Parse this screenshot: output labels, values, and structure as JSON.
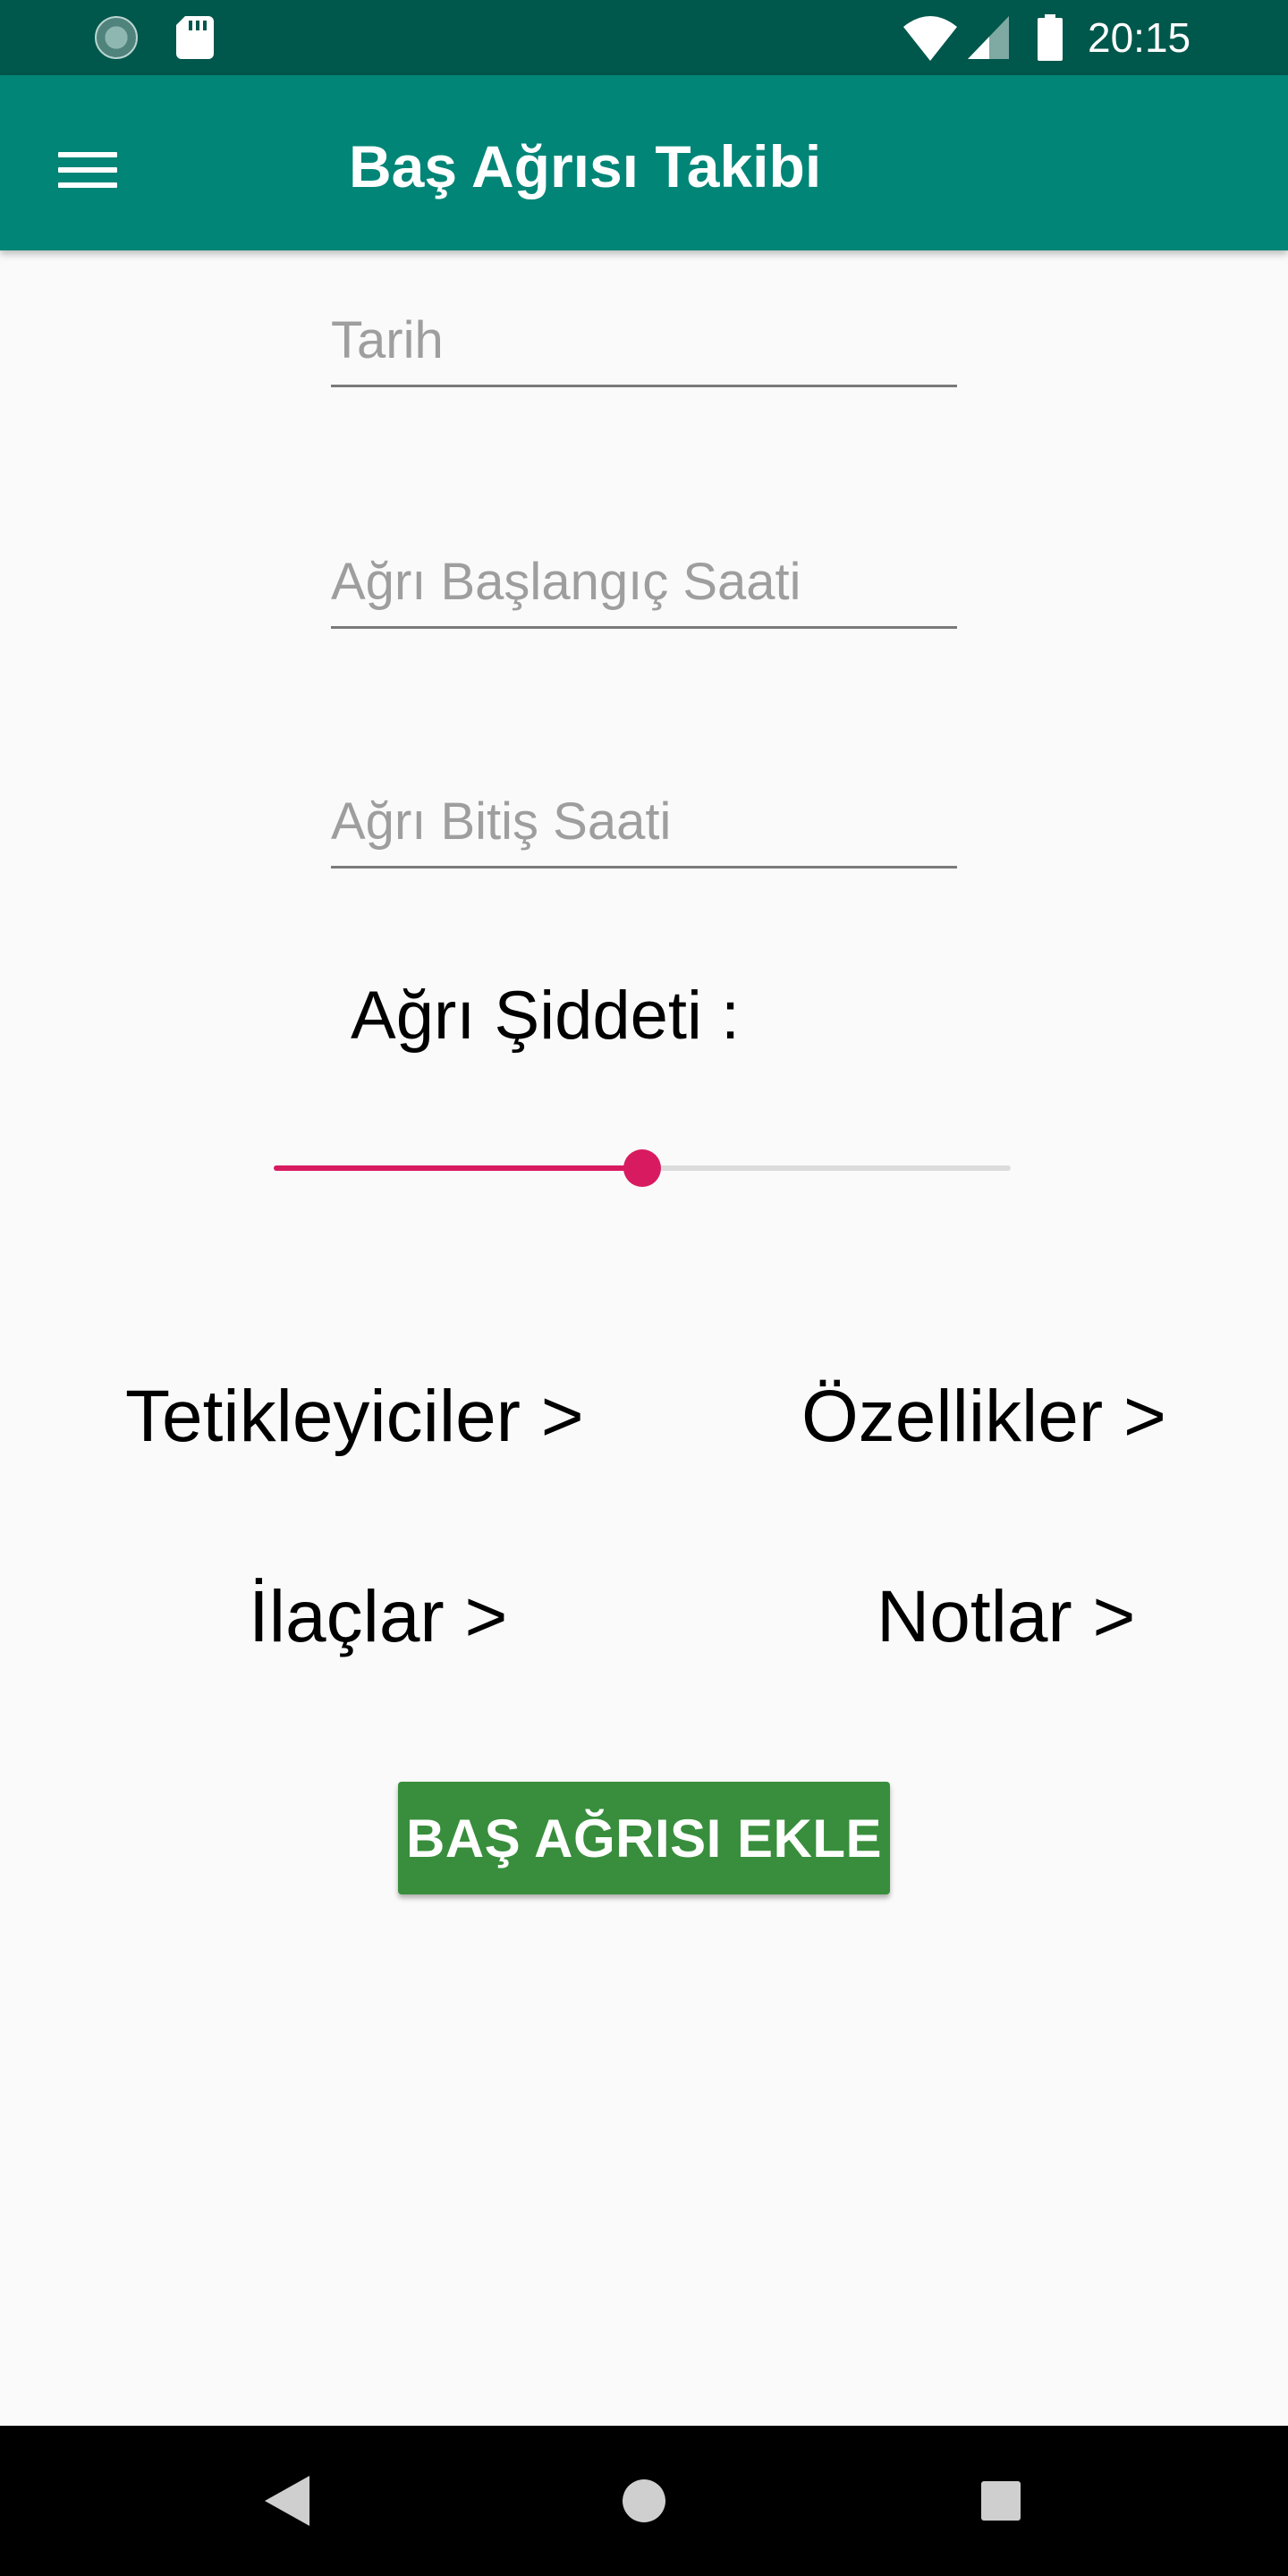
{
  "status_bar": {
    "time": "20:15",
    "icons": [
      "sync-icon",
      "sd-card-icon",
      "wifi-icon",
      "signal-icon",
      "battery-icon"
    ]
  },
  "app_bar": {
    "title": "Baş Ağrısı Takibi",
    "menu_icon": "hamburger-menu-icon"
  },
  "form": {
    "date_placeholder": "Tarih",
    "start_time_placeholder": "Ağrı Başlangıç Saati",
    "end_time_placeholder": "Ağrı Bitiş Saati",
    "severity_label": "Ağrı Şiddeti :",
    "severity_slider": {
      "value_fraction": 0.5,
      "accent_color": "#d81b60"
    }
  },
  "links": {
    "triggers": "Tetikleyiciler  >",
    "features": "Özellikler >",
    "medications": "İlaçlar >",
    "notes": "Notlar >"
  },
  "actions": {
    "add_button_label": "BAŞ AĞRISI EKLE",
    "add_button_color": "#388e3c"
  },
  "colors": {
    "status_bar": "#00574b",
    "app_bar": "#008577"
  },
  "nav_bar": {
    "icons": [
      "back-icon",
      "home-icon",
      "recents-icon"
    ]
  }
}
